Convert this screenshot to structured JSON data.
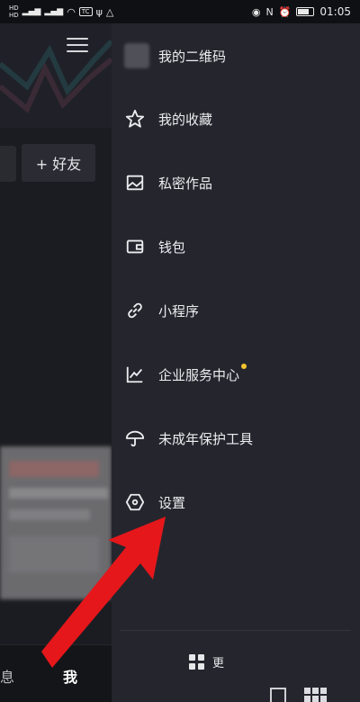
{
  "status_bar": {
    "hd_top": "HD",
    "hd_bottom": "HD",
    "signal1": "⁴ᴳ",
    "signal2": "⁴ᴳ",
    "badge": "TC",
    "time": "01:05"
  },
  "background_page": {
    "add_friend_label": "+ 好友",
    "tab_messages": "息",
    "tab_me": "我"
  },
  "drawer": {
    "items": [
      {
        "label": "我的二维码",
        "icon": "qr-avatar-thumb"
      },
      {
        "label": "我的收藏",
        "icon": "star-icon"
      },
      {
        "label": "私密作品",
        "icon": "private-image-icon"
      },
      {
        "label": "钱包",
        "icon": "wallet-icon"
      },
      {
        "label": "小程序",
        "icon": "link-icon"
      },
      {
        "label": "企业服务中心",
        "icon": "chart-line-icon",
        "has_dot": true
      },
      {
        "label": "未成年保护工具",
        "icon": "umbrella-icon"
      },
      {
        "label": "设置",
        "icon": "hexagon-settings-icon"
      }
    ],
    "more_label": "更"
  },
  "colors": {
    "drawer_bg": "#25262d",
    "dot": "#f4c430",
    "arrow": "#e5171b"
  }
}
